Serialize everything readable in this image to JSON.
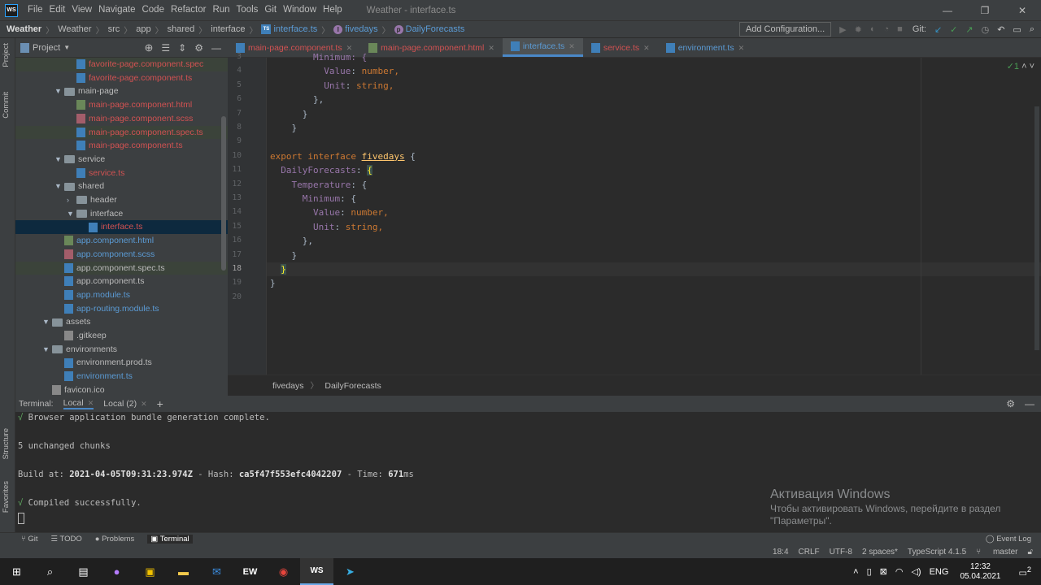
{
  "menubar": {
    "items": [
      "File",
      "Edit",
      "View",
      "Navigate",
      "Code",
      "Refactor",
      "Run",
      "Tools",
      "Git",
      "Window",
      "Help"
    ],
    "title": "Weather - interface.ts"
  },
  "navbar": {
    "crumbs": [
      "Weather",
      "Weather",
      "src",
      "app",
      "shared",
      "interface"
    ],
    "file": "interface.ts",
    "symbol1": "fivedays",
    "symbol2": "DailyForecasts",
    "add_config": "Add Configuration...",
    "git_label": "Git:"
  },
  "project": {
    "title": "Project",
    "tree": [
      {
        "label": "favorite-page.component.spec",
        "color": "red",
        "icon": "ts",
        "depth": 5,
        "arrow": "",
        "hl": true
      },
      {
        "label": "favorite-page.component.ts",
        "color": "red",
        "icon": "ts",
        "depth": 5,
        "arrow": ""
      },
      {
        "label": "main-page",
        "color": "def",
        "icon": "folder",
        "depth": 4,
        "arrow": "▼"
      },
      {
        "label": "main-page.component.html",
        "color": "red",
        "icon": "html",
        "depth": 5,
        "arrow": ""
      },
      {
        "label": "main-page.component.scss",
        "color": "red",
        "icon": "scss",
        "depth": 5,
        "arrow": ""
      },
      {
        "label": "main-page.component.spec.ts",
        "color": "red",
        "icon": "ts",
        "depth": 5,
        "arrow": "",
        "hl": true
      },
      {
        "label": "main-page.component.ts",
        "color": "red",
        "icon": "ts",
        "depth": 5,
        "arrow": ""
      },
      {
        "label": "service",
        "color": "def",
        "icon": "folder",
        "depth": 4,
        "arrow": "▼"
      },
      {
        "label": "service.ts",
        "color": "red",
        "icon": "ts",
        "depth": 5,
        "arrow": ""
      },
      {
        "label": "shared",
        "color": "def",
        "icon": "folder",
        "depth": 4,
        "arrow": "▼"
      },
      {
        "label": "header",
        "color": "def",
        "icon": "folder",
        "depth": 5,
        "arrow": "›"
      },
      {
        "label": "interface",
        "color": "def",
        "icon": "folder",
        "depth": 5,
        "arrow": "▼"
      },
      {
        "label": "interface.ts",
        "color": "red",
        "icon": "ts",
        "depth": 6,
        "arrow": "",
        "sel": true
      },
      {
        "label": "app.component.html",
        "color": "blue",
        "icon": "html",
        "depth": 4,
        "arrow": ""
      },
      {
        "label": "app.component.scss",
        "color": "blue",
        "icon": "scss",
        "depth": 4,
        "arrow": ""
      },
      {
        "label": "app.component.spec.ts",
        "color": "def",
        "icon": "ts",
        "depth": 4,
        "arrow": "",
        "hl": true
      },
      {
        "label": "app.component.ts",
        "color": "def",
        "icon": "ts",
        "depth": 4,
        "arrow": ""
      },
      {
        "label": "app.module.ts",
        "color": "blue",
        "icon": "ts",
        "depth": 4,
        "arrow": ""
      },
      {
        "label": "app-routing.module.ts",
        "color": "blue",
        "icon": "ts",
        "depth": 4,
        "arrow": ""
      },
      {
        "label": "assets",
        "color": "def",
        "icon": "folder",
        "depth": 3,
        "arrow": "▼"
      },
      {
        "label": ".gitkeep",
        "color": "def",
        "icon": "misc",
        "depth": 4,
        "arrow": ""
      },
      {
        "label": "environments",
        "color": "def",
        "icon": "folder",
        "depth": 3,
        "arrow": "▼"
      },
      {
        "label": "environment.prod.ts",
        "color": "def",
        "icon": "ts",
        "depth": 4,
        "arrow": ""
      },
      {
        "label": "environment.ts",
        "color": "blue",
        "icon": "ts",
        "depth": 4,
        "arrow": ""
      },
      {
        "label": "favicon.ico",
        "color": "def",
        "icon": "misc",
        "depth": 3,
        "arrow": ""
      }
    ]
  },
  "tabs": [
    {
      "label": "main-page.component.ts",
      "color": "red",
      "icon": "ts"
    },
    {
      "label": "main-page.component.html",
      "color": "red",
      "icon": "html"
    },
    {
      "label": "interface.ts",
      "color": "blue",
      "icon": "ts",
      "active": true
    },
    {
      "label": "service.ts",
      "color": "red",
      "icon": "ts"
    },
    {
      "label": "environment.ts",
      "color": "blue",
      "icon": "ts"
    }
  ],
  "editor": {
    "line_numbers": [
      "3",
      "4",
      "5",
      "6",
      "7",
      "8",
      "9",
      "10",
      "11",
      "12",
      "13",
      "14",
      "15",
      "16",
      "17",
      "18",
      "19",
      "20"
    ],
    "current_line": "18",
    "inspections": "✓1",
    "lines": [
      [
        {
          "t": "        Minimum: {",
          "c": "pr"
        }
      ],
      [
        {
          "t": "          Value",
          "c": "pr"
        },
        {
          "t": ": ",
          "c": "pn"
        },
        {
          "t": "number",
          "c": "ty"
        },
        {
          "t": ",",
          "c": "kw"
        }
      ],
      [
        {
          "t": "          Unit",
          "c": "pr"
        },
        {
          "t": ": ",
          "c": "pn"
        },
        {
          "t": "string",
          "c": "ty"
        },
        {
          "t": ",",
          "c": "kw"
        }
      ],
      [
        {
          "t": "        },",
          "c": "pn"
        }
      ],
      [
        {
          "t": "      }",
          "c": "pn"
        }
      ],
      [
        {
          "t": "    }",
          "c": "pn"
        }
      ],
      [
        {
          "t": "",
          "c": "pn"
        }
      ],
      [
        {
          "t": "export interface ",
          "c": "kw"
        },
        {
          "t": "fivedays",
          "c": "fn"
        },
        {
          "t": " {",
          "c": "pn"
        }
      ],
      [
        {
          "t": "  DailyForecasts",
          "c": "pr"
        },
        {
          "t": ": ",
          "c": "pn"
        },
        {
          "t": "{",
          "c": "brk"
        }
      ],
      [
        {
          "t": "    Temperature",
          "c": "pr"
        },
        {
          "t": ": {",
          "c": "pn"
        }
      ],
      [
        {
          "t": "      Minimum",
          "c": "pr"
        },
        {
          "t": ": {",
          "c": "pn"
        }
      ],
      [
        {
          "t": "        Value",
          "c": "pr"
        },
        {
          "t": ": ",
          "c": "pn"
        },
        {
          "t": "number",
          "c": "ty"
        },
        {
          "t": ",",
          "c": "kw"
        }
      ],
      [
        {
          "t": "        Unit",
          "c": "pr"
        },
        {
          "t": ": ",
          "c": "pn"
        },
        {
          "t": "string",
          "c": "ty"
        },
        {
          "t": ",",
          "c": "kw"
        }
      ],
      [
        {
          "t": "      },",
          "c": "pn"
        }
      ],
      [
        {
          "t": "    }",
          "c": "pn"
        }
      ],
      [
        {
          "t": "  ",
          "c": "pn"
        },
        {
          "t": "}",
          "c": "brk"
        }
      ],
      [
        {
          "t": "}",
          "c": "pn"
        }
      ],
      [
        {
          "t": "",
          "c": "pn"
        }
      ]
    ],
    "breadcrumb": [
      "fivedays",
      "DailyForecasts"
    ]
  },
  "terminal": {
    "label": "Terminal:",
    "tabs": [
      "Local",
      "Local (2)"
    ],
    "line1": " Browser application bundle generation complete.",
    "line2": "5 unchanged chunks",
    "build_prefix": "Build at: ",
    "build_time": "2021-04-05T09:31:23.974Z",
    "hash_prefix": " - Hash: ",
    "hash": "ca5f47f553efc4042207",
    "time_prefix": " - Time: ",
    "time": "671",
    "time_unit": "ms",
    "line4": " Compiled successfully.",
    "check": "√"
  },
  "activation": {
    "title": "Активация Windows",
    "line1": "Чтобы активировать Windows, перейдите в раздел",
    "line2": "\"Параметры\"."
  },
  "sidebar_labels": {
    "project": "Project",
    "commit": "Commit",
    "structure": "Structure",
    "favorites": "Favorites"
  },
  "toolwindows": [
    "Git",
    "TODO",
    "Problems",
    "Terminal"
  ],
  "event_log": "Event Log",
  "status": {
    "position": "18:4",
    "line_sep": "CRLF",
    "encoding": "UTF-8",
    "indent": "2 spaces*",
    "lang": "TypeScript 4.1.5",
    "branch": "master"
  },
  "taskbar": {
    "lang": "ENG",
    "time": "12:32",
    "date": "05.04.2021",
    "notifications": "2"
  }
}
